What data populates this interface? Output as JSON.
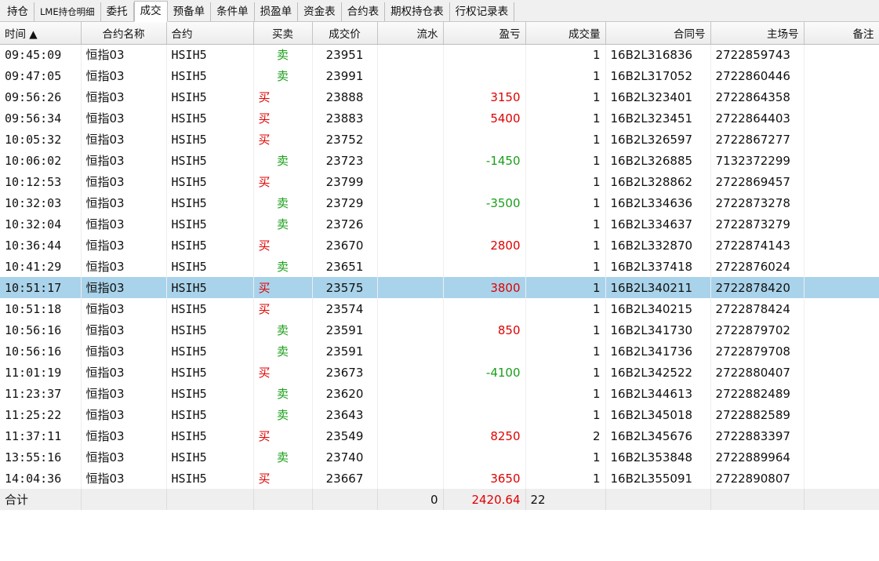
{
  "tabs": [
    {
      "label": "持仓",
      "active": false
    },
    {
      "label": "LME持仓明细",
      "active": false
    },
    {
      "label": "委托",
      "active": false
    },
    {
      "label": "成交",
      "active": true
    },
    {
      "label": "预备单",
      "active": false
    },
    {
      "label": "条件单",
      "active": false
    },
    {
      "label": "损盈单",
      "active": false
    },
    {
      "label": "资金表",
      "active": false
    },
    {
      "label": "合约表",
      "active": false
    },
    {
      "label": "期权持仓表",
      "active": false
    },
    {
      "label": "行权记录表",
      "active": false
    }
  ],
  "columns": [
    "时间 ▲",
    "合约名称",
    "合约",
    "买卖",
    "成交价",
    "流水",
    "盈亏",
    "成交量",
    "合同号",
    "主场号",
    "备注"
  ],
  "colors": {
    "buy": "#e00000",
    "sell": "#1a9e1a",
    "selected_row": "#a9d3ea"
  },
  "rows": [
    {
      "time": "09:45:09",
      "name": "恒指03",
      "code": "HSIH5",
      "side": "卖",
      "price": "23951",
      "flow": "",
      "pnl": "",
      "qty": "1",
      "contract": "16B2L316836",
      "master": "2722859743",
      "note": ""
    },
    {
      "time": "09:47:05",
      "name": "恒指03",
      "code": "HSIH5",
      "side": "卖",
      "price": "23991",
      "flow": "",
      "pnl": "",
      "qty": "1",
      "contract": "16B2L317052",
      "master": "2722860446",
      "note": ""
    },
    {
      "time": "09:56:26",
      "name": "恒指03",
      "code": "HSIH5",
      "side": "买",
      "price": "23888",
      "flow": "",
      "pnl": "3150",
      "qty": "1",
      "contract": "16B2L323401",
      "master": "2722864358",
      "note": ""
    },
    {
      "time": "09:56:34",
      "name": "恒指03",
      "code": "HSIH5",
      "side": "买",
      "price": "23883",
      "flow": "",
      "pnl": "5400",
      "qty": "1",
      "contract": "16B2L323451",
      "master": "2722864403",
      "note": ""
    },
    {
      "time": "10:05:32",
      "name": "恒指03",
      "code": "HSIH5",
      "side": "买",
      "price": "23752",
      "flow": "",
      "pnl": "",
      "qty": "1",
      "contract": "16B2L326597",
      "master": "2722867277",
      "note": ""
    },
    {
      "time": "10:06:02",
      "name": "恒指03",
      "code": "HSIH5",
      "side": "卖",
      "price": "23723",
      "flow": "",
      "pnl": "-1450",
      "qty": "1",
      "contract": "16B2L326885",
      "master": "7132372299",
      "note": ""
    },
    {
      "time": "10:12:53",
      "name": "恒指03",
      "code": "HSIH5",
      "side": "买",
      "price": "23799",
      "flow": "",
      "pnl": "",
      "qty": "1",
      "contract": "16B2L328862",
      "master": "2722869457",
      "note": ""
    },
    {
      "time": "10:32:03",
      "name": "恒指03",
      "code": "HSIH5",
      "side": "卖",
      "price": "23729",
      "flow": "",
      "pnl": "-3500",
      "qty": "1",
      "contract": "16B2L334636",
      "master": "2722873278",
      "note": ""
    },
    {
      "time": "10:32:04",
      "name": "恒指03",
      "code": "HSIH5",
      "side": "卖",
      "price": "23726",
      "flow": "",
      "pnl": "",
      "qty": "1",
      "contract": "16B2L334637",
      "master": "2722873279",
      "note": ""
    },
    {
      "time": "10:36:44",
      "name": "恒指03",
      "code": "HSIH5",
      "side": "买",
      "price": "23670",
      "flow": "",
      "pnl": "2800",
      "qty": "1",
      "contract": "16B2L332870",
      "master": "2722874143",
      "note": ""
    },
    {
      "time": "10:41:29",
      "name": "恒指03",
      "code": "HSIH5",
      "side": "卖",
      "price": "23651",
      "flow": "",
      "pnl": "",
      "qty": "1",
      "contract": "16B2L337418",
      "master": "2722876024",
      "note": ""
    },
    {
      "time": "10:51:17",
      "name": "恒指03",
      "code": "HSIH5",
      "side": "买",
      "price": "23575",
      "flow": "",
      "pnl": "3800",
      "qty": "1",
      "contract": "16B2L340211",
      "master": "2722878420",
      "note": "",
      "selected": true
    },
    {
      "time": "10:51:18",
      "name": "恒指03",
      "code": "HSIH5",
      "side": "买",
      "price": "23574",
      "flow": "",
      "pnl": "",
      "qty": "1",
      "contract": "16B2L340215",
      "master": "2722878424",
      "note": ""
    },
    {
      "time": "10:56:16",
      "name": "恒指03",
      "code": "HSIH5",
      "side": "卖",
      "price": "23591",
      "flow": "",
      "pnl": "850",
      "qty": "1",
      "contract": "16B2L341730",
      "master": "2722879702",
      "note": ""
    },
    {
      "time": "10:56:16",
      "name": "恒指03",
      "code": "HSIH5",
      "side": "卖",
      "price": "23591",
      "flow": "",
      "pnl": "",
      "qty": "1",
      "contract": "16B2L341736",
      "master": "2722879708",
      "note": ""
    },
    {
      "time": "11:01:19",
      "name": "恒指03",
      "code": "HSIH5",
      "side": "买",
      "price": "23673",
      "flow": "",
      "pnl": "-4100",
      "qty": "1",
      "contract": "16B2L342522",
      "master": "2722880407",
      "note": ""
    },
    {
      "time": "11:23:37",
      "name": "恒指03",
      "code": "HSIH5",
      "side": "卖",
      "price": "23620",
      "flow": "",
      "pnl": "",
      "qty": "1",
      "contract": "16B2L344613",
      "master": "2722882489",
      "note": ""
    },
    {
      "time": "11:25:22",
      "name": "恒指03",
      "code": "HSIH5",
      "side": "卖",
      "price": "23643",
      "flow": "",
      "pnl": "",
      "qty": "1",
      "contract": "16B2L345018",
      "master": "2722882589",
      "note": ""
    },
    {
      "time": "11:37:11",
      "name": "恒指03",
      "code": "HSIH5",
      "side": "买",
      "price": "23549",
      "flow": "",
      "pnl": "8250",
      "qty": "2",
      "contract": "16B2L345676",
      "master": "2722883397",
      "note": ""
    },
    {
      "time": "13:55:16",
      "name": "恒指03",
      "code": "HSIH5",
      "side": "卖",
      "price": "23740",
      "flow": "",
      "pnl": "",
      "qty": "1",
      "contract": "16B2L353848",
      "master": "2722889964",
      "note": ""
    },
    {
      "time": "14:04:36",
      "name": "恒指03",
      "code": "HSIH5",
      "side": "买",
      "price": "23667",
      "flow": "",
      "pnl": "3650",
      "qty": "1",
      "contract": "16B2L355091",
      "master": "2722890807",
      "note": ""
    }
  ],
  "total": {
    "label": "合计",
    "flow": "0",
    "pnl": "2420.64",
    "qty": "22"
  }
}
